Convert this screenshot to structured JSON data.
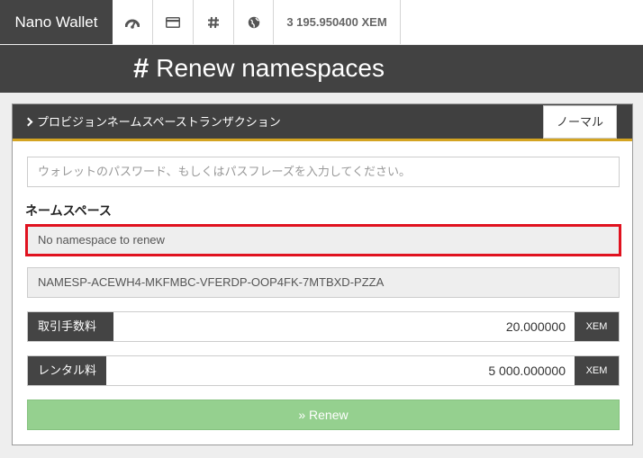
{
  "nav": {
    "brand": "Nano Wallet",
    "icons": [
      "dashboard-icon",
      "card-icon",
      "hash-icon",
      "globe-icon"
    ],
    "balance": "3 195.950400 XEM"
  },
  "page": {
    "title": "Renew namespaces"
  },
  "panel": {
    "title": "プロビジョンネームスペーストランザクション",
    "mode_button": "ノーマル",
    "password_placeholder": "ウォレットのパスワード、もしくはパスフレーズを入力してください。",
    "namespace_label": "ネームスペース",
    "namespace_selected": "No namespace to renew",
    "address": "NAMESP-ACEWH4-MKFMBC-VFERDP-OOP4FK-7MTBXD-PZZA",
    "fee": {
      "label": "取引手数料",
      "value": "20.000000",
      "unit": "XEM"
    },
    "rental": {
      "label": "レンタル料",
      "value": "5 000.000000",
      "unit": "XEM"
    },
    "renew_button": "» Renew"
  },
  "colors": {
    "dark": "#444444",
    "accent_underline": "#d4a422",
    "highlight_border": "#e0121f",
    "renew_green": "#95d08f"
  }
}
